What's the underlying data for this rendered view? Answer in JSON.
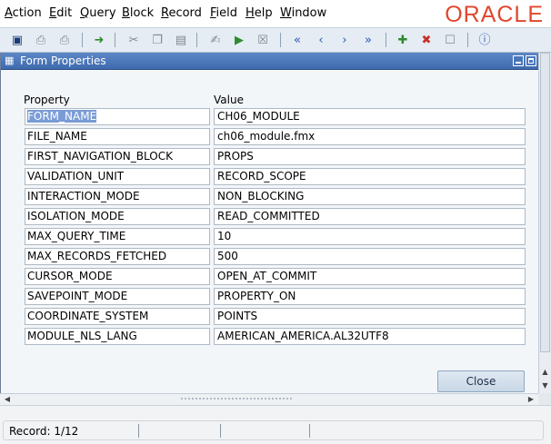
{
  "menu": {
    "items": [
      {
        "key": "A",
        "rest": "ction"
      },
      {
        "key": "E",
        "rest": "dit"
      },
      {
        "key": "Q",
        "rest": "uery"
      },
      {
        "key": "B",
        "rest": "lock"
      },
      {
        "key": "R",
        "rest": "ecord"
      },
      {
        "key": "F",
        "rest": "ield"
      },
      {
        "key": "H",
        "rest": "elp"
      },
      {
        "key": "W",
        "rest": "indow"
      }
    ],
    "logo": "ORACLE"
  },
  "toolbar": {
    "icons": [
      "save-icon",
      "print-icon",
      "print-setup-icon",
      "exit-icon",
      "cut-icon",
      "copy-icon",
      "paste-icon",
      "enter-query-icon",
      "execute-query-icon",
      "cancel-query-icon",
      "first-record-icon",
      "previous-record-icon",
      "next-record-icon",
      "last-record-icon",
      "insert-record-icon",
      "delete-record-icon",
      "lock-record-icon",
      "help-icon"
    ]
  },
  "window": {
    "title": "Form Properties",
    "col_property": "Property",
    "col_value": "Value",
    "close_label": "Close"
  },
  "rows": [
    {
      "property": "FORM_NAME",
      "value": "CH06_MODULE"
    },
    {
      "property": "FILE_NAME",
      "value": "ch06_module.fmx"
    },
    {
      "property": "FIRST_NAVIGATION_BLOCK",
      "value": "PROPS"
    },
    {
      "property": "VALIDATION_UNIT",
      "value": "RECORD_SCOPE"
    },
    {
      "property": "INTERACTION_MODE",
      "value": "NON_BLOCKING"
    },
    {
      "property": "ISOLATION_MODE",
      "value": "READ_COMMITTED"
    },
    {
      "property": "MAX_QUERY_TIME",
      "value": "10"
    },
    {
      "property": "MAX_RECORDS_FETCHED",
      "value": "500"
    },
    {
      "property": "CURSOR_MODE",
      "value": "OPEN_AT_COMMIT"
    },
    {
      "property": "SAVEPOINT_MODE",
      "value": "PROPERTY_ON"
    },
    {
      "property": "COORDINATE_SYSTEM",
      "value": "POINTS"
    },
    {
      "property": "MODULE_NLS_LANG",
      "value": "AMERICAN_AMERICA.AL32UTF8"
    }
  ],
  "status": {
    "record": "Record: 1/12"
  }
}
